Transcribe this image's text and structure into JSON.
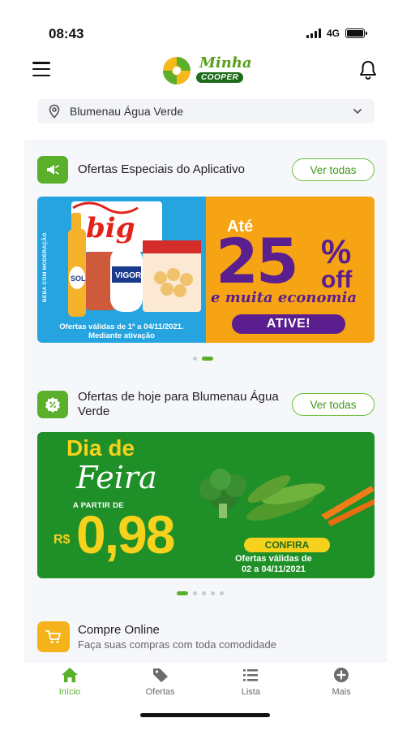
{
  "status_bar": {
    "time": "08:43",
    "network": "4G"
  },
  "header": {
    "logo_line1": "Minha",
    "logo_line2": "COOPER"
  },
  "location": {
    "label": "Blumenau Água Verde"
  },
  "sections": {
    "app_offers": {
      "title": "Ofertas Especiais do Aplicativo",
      "button": "Ver todas",
      "banner": {
        "vertical_note": "BEBA COM MODERAÇÃO",
        "validity_line1": "Ofertas válidas de 1º a 04/11/2021.",
        "validity_line2": "Mediante ativação",
        "until": "Até",
        "discount": "25",
        "percent_sign": "%",
        "off": "off",
        "slogan": "e muita economia",
        "cta": "ATIVE!"
      },
      "carousel": {
        "count": 2,
        "active": 1
      }
    },
    "today_offers": {
      "title": "Ofertas de hoje para Blumenau Água Verde",
      "button": "Ver todas",
      "banner": {
        "line1": "Dia de",
        "line2": "Feira",
        "from": "A PARTIR DE",
        "currency": "R$",
        "price": "0,98",
        "cta": "CONFIRA",
        "validity_line1": "Ofertas válidas de",
        "validity_line2": "02 a 04/11/2021"
      },
      "carousel": {
        "count": 5,
        "active": 0
      }
    },
    "online": {
      "title": "Compre Online",
      "subtitle": "Faça suas compras com toda comodidade"
    }
  },
  "tabbar": {
    "tabs": [
      {
        "label": "Início",
        "icon": "home-icon"
      },
      {
        "label": "Ofertas",
        "icon": "tag-icon"
      },
      {
        "label": "Lista",
        "icon": "list-icon"
      },
      {
        "label": "Mais",
        "icon": "plus-circle-icon"
      }
    ],
    "active": 0
  },
  "colors": {
    "brand_green": "#5aaf2b",
    "accent_orange": "#f7a414",
    "accent_purple": "#5a1e8f",
    "banner_green": "#1f8f28",
    "cart_yellow": "#f5b21a"
  }
}
